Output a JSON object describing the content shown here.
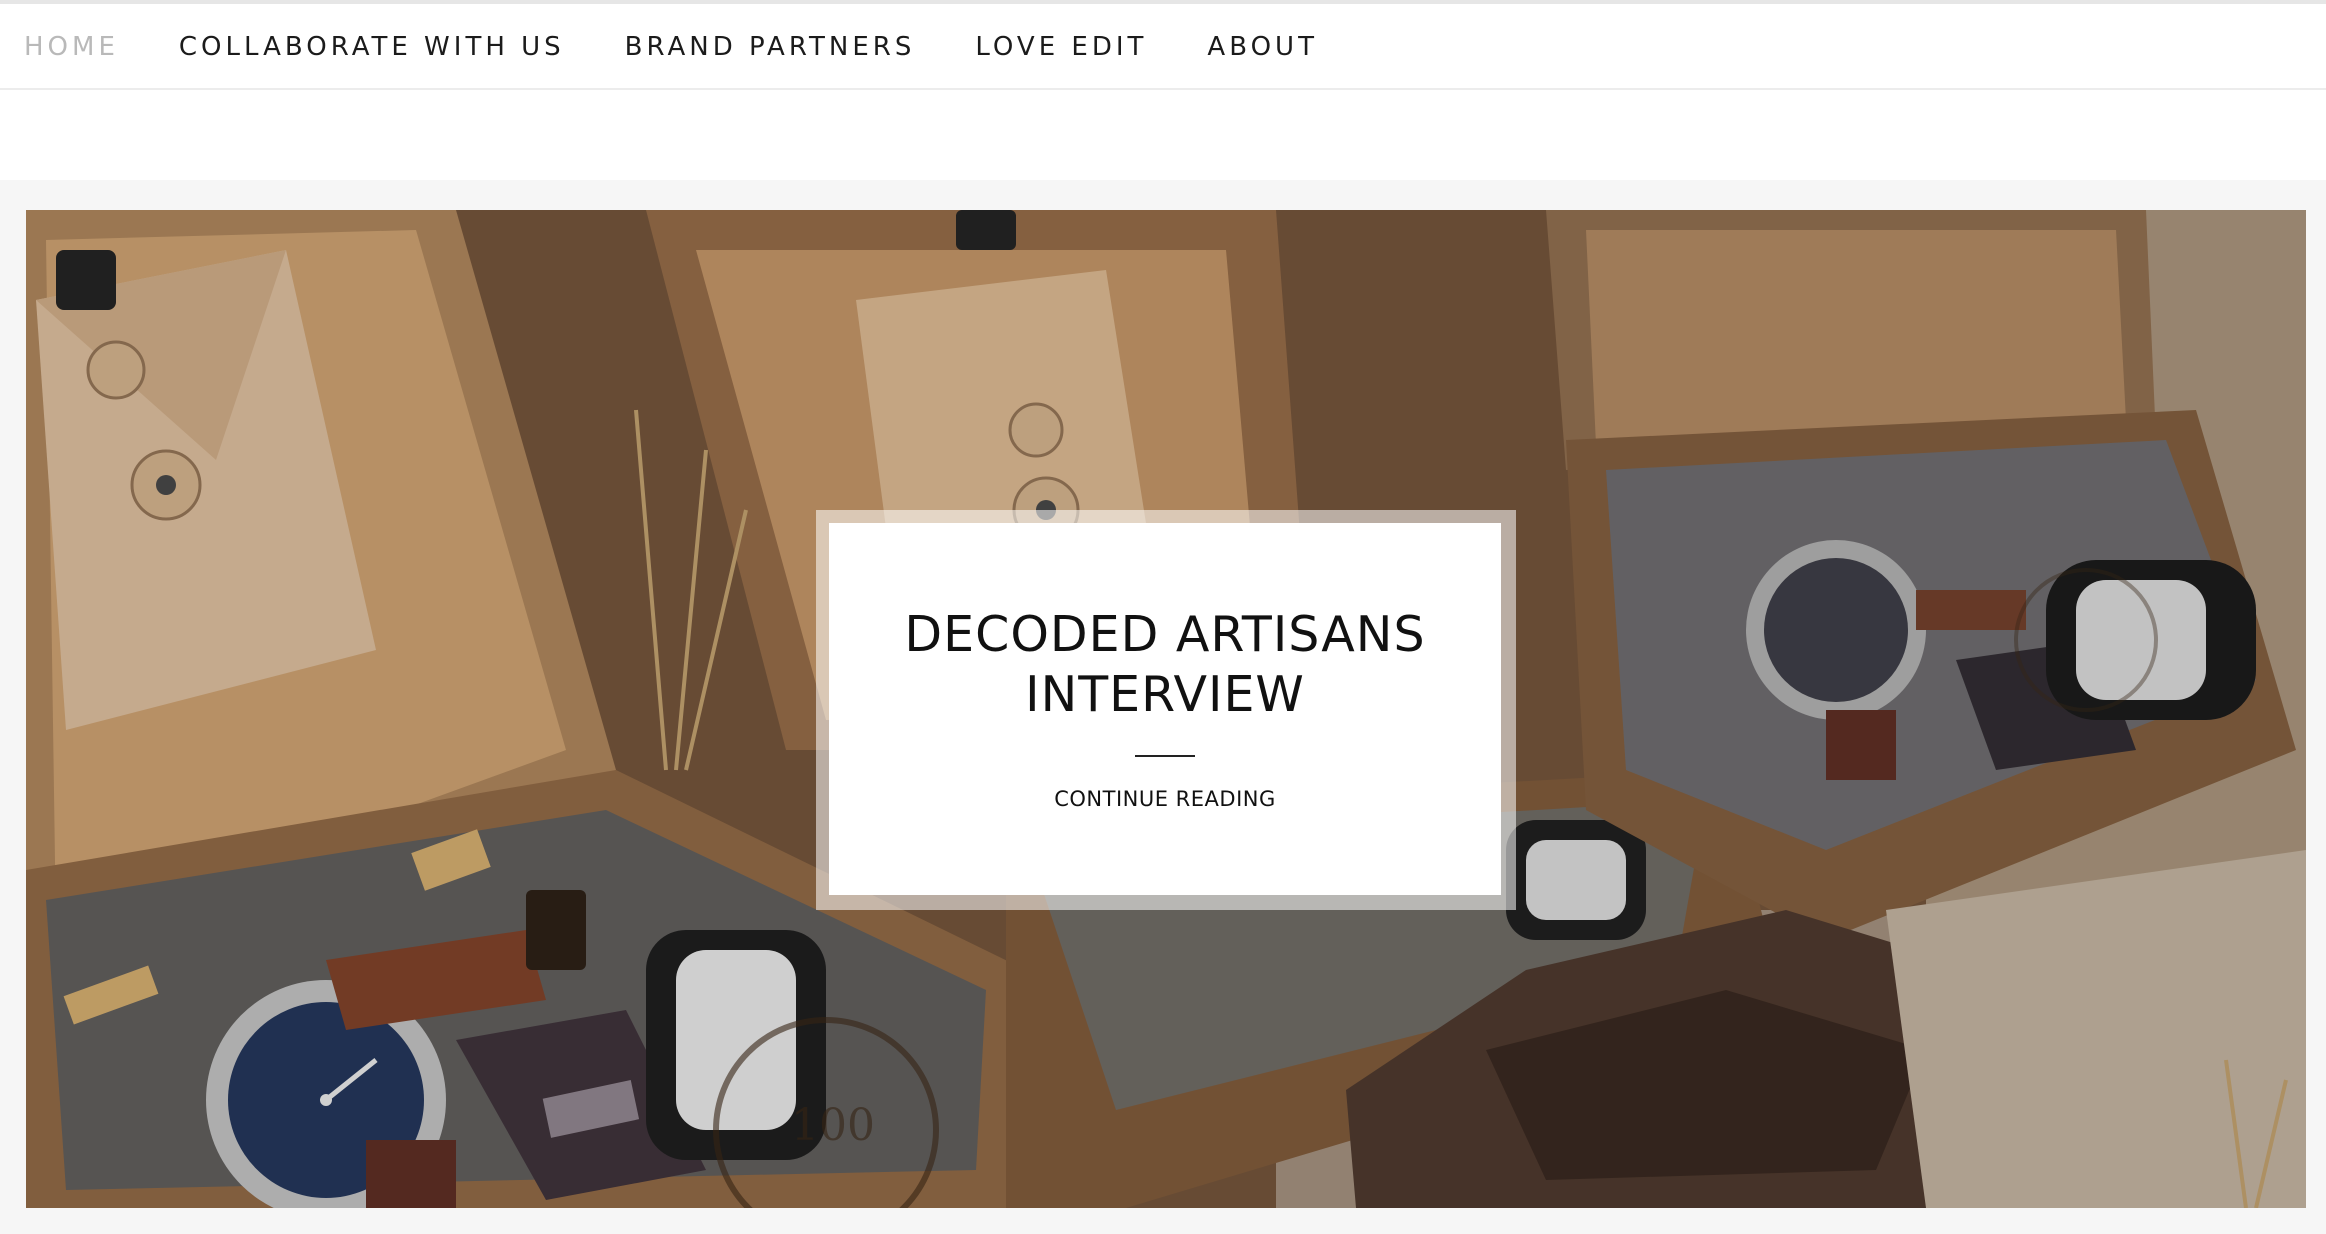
{
  "nav": {
    "items": [
      {
        "label": "HOME",
        "active": true
      },
      {
        "label": "COLLABORATE WITH US",
        "active": false
      },
      {
        "label": "BRAND PARTNERS",
        "active": false
      },
      {
        "label": "LOVE EDIT",
        "active": false
      },
      {
        "label": "ABOUT",
        "active": false
      }
    ]
  },
  "featured": {
    "title": "DECODED ARTISANS INTERVIEW",
    "cta": "CONTINUE READING",
    "image": "wooden-gift-boxes-with-watches-photo"
  },
  "colors": {
    "nav_active": "#b9b9b9",
    "nav_text": "#1b1b1b",
    "band_bg": "#f6f6f6"
  }
}
